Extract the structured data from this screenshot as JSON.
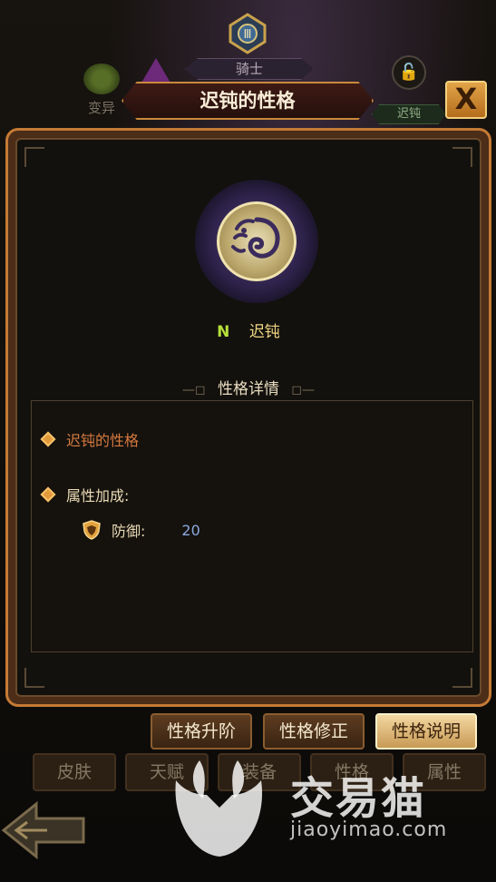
{
  "top": {
    "class_label": "骑士",
    "mutate_label": "变异",
    "slow_tag": "迟钝",
    "emblem_numeral": "Ⅲ"
  },
  "dialog": {
    "title": "迟钝的性格",
    "close_label": "X"
  },
  "trait": {
    "grade": "N",
    "name": "迟钝",
    "icon": "swirl-beast-icon"
  },
  "details": {
    "section_title": "性格详情",
    "trait_label": "迟钝的性格",
    "bonus_label": "属性加成:",
    "stat": {
      "name": "防御:",
      "value": "20",
      "icon": "shield-icon"
    }
  },
  "action_tabs": [
    {
      "label": "性格升阶",
      "active": false
    },
    {
      "label": "性格修正",
      "active": false
    },
    {
      "label": "性格说明",
      "active": true
    }
  ],
  "nav_tabs": [
    "皮肤",
    "天赋",
    "装备",
    "性格",
    "属性"
  ],
  "watermark": {
    "text": "交易猫",
    "url": "jiaoyimao.com"
  },
  "colors": {
    "panel_border": "#c57a35",
    "grade_color": "#b5e03a",
    "name_color": "#f0d684",
    "stat_value_color": "#8aa8e0",
    "diamond_color": "#e19a3a"
  }
}
